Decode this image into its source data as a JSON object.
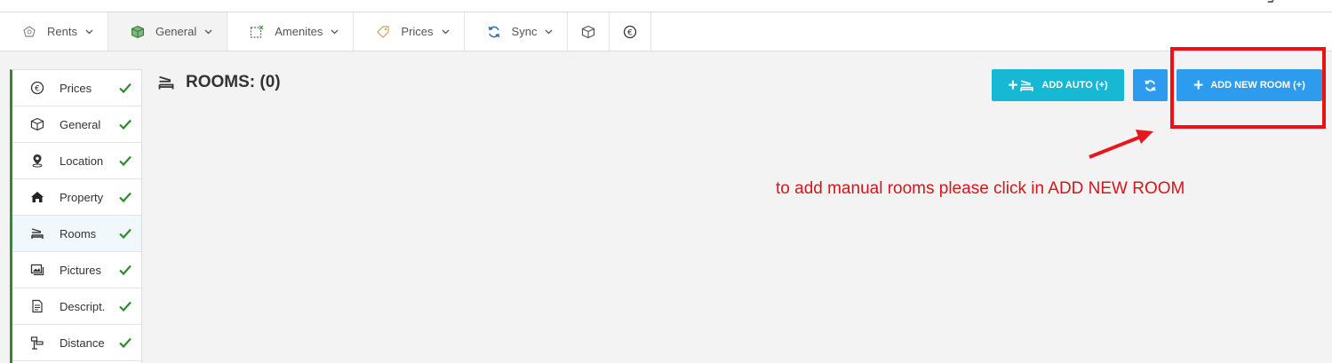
{
  "menu": {
    "items": [
      {
        "label": "Rents",
        "icon": "rents-icon"
      },
      {
        "label": "General",
        "icon": "cube-icon"
      },
      {
        "label": "Amenites",
        "icon": "amenities-icon"
      },
      {
        "label": "Prices",
        "icon": "tag-icon"
      },
      {
        "label": "Sync",
        "icon": "sync-icon"
      }
    ],
    "icon_only": [
      "cube-icon",
      "euro-icon"
    ],
    "active_index": 1
  },
  "sidebar": {
    "items": [
      {
        "label": "Prices",
        "icon": "euro-icon",
        "done": true
      },
      {
        "label": "General",
        "icon": "cube-icon",
        "done": true
      },
      {
        "label": "Location",
        "icon": "location-pin-icon",
        "done": true
      },
      {
        "label": "Property",
        "icon": "house-icon",
        "done": true
      },
      {
        "label": "Rooms",
        "icon": "bed-icon",
        "done": true
      },
      {
        "label": "Pictures",
        "icon": "pictures-icon",
        "done": true
      },
      {
        "label": "Descript.",
        "icon": "document-icon",
        "done": true
      },
      {
        "label": "Distance",
        "icon": "distance-icon",
        "done": true
      }
    ],
    "active_index": 4
  },
  "page": {
    "title": "ROOMS: (0)"
  },
  "actions": {
    "add_auto_label": "ADD AUTO (+)",
    "add_new_room_label": "ADD NEW ROOM (+)",
    "plus": "+"
  },
  "annotation": {
    "note": "to add manual rooms please click in ADD NEW ROOM"
  },
  "colors": {
    "accent_green": "#2e8b2e",
    "add_auto": "#17b8d4",
    "primary": "#2d9cee",
    "annotation_red": "#ee1111"
  }
}
